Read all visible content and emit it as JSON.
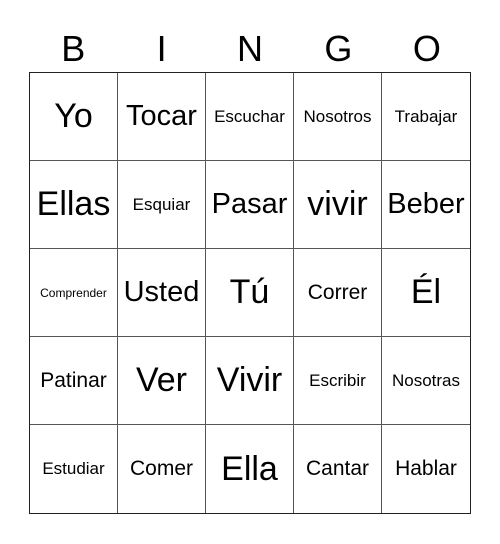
{
  "header": [
    "B",
    "I",
    "N",
    "G",
    "O"
  ],
  "cells": [
    {
      "text": "Yo",
      "size": "xl"
    },
    {
      "text": "Tocar",
      "size": "l"
    },
    {
      "text": "Escuchar",
      "size": "s"
    },
    {
      "text": "Nosotros",
      "size": "s"
    },
    {
      "text": "Trabajar",
      "size": "s"
    },
    {
      "text": "Ellas",
      "size": "xl"
    },
    {
      "text": "Esquiar",
      "size": "s"
    },
    {
      "text": "Pasar",
      "size": "l"
    },
    {
      "text": "vivir",
      "size": "xl"
    },
    {
      "text": "Beber",
      "size": "l"
    },
    {
      "text": "Comprender",
      "size": "xs"
    },
    {
      "text": "Usted",
      "size": "l"
    },
    {
      "text": "Tú",
      "size": "xl"
    },
    {
      "text": "Correr",
      "size": "m"
    },
    {
      "text": "Él",
      "size": "xl"
    },
    {
      "text": "Patinar",
      "size": "m"
    },
    {
      "text": "Ver",
      "size": "xl"
    },
    {
      "text": "Vivir",
      "size": "xl"
    },
    {
      "text": "Escribir",
      "size": "s"
    },
    {
      "text": "Nosotras",
      "size": "s"
    },
    {
      "text": "Estudiar",
      "size": "s"
    },
    {
      "text": "Comer",
      "size": "m"
    },
    {
      "text": "Ella",
      "size": "xl"
    },
    {
      "text": "Cantar",
      "size": "m"
    },
    {
      "text": "Hablar",
      "size": "m"
    }
  ]
}
